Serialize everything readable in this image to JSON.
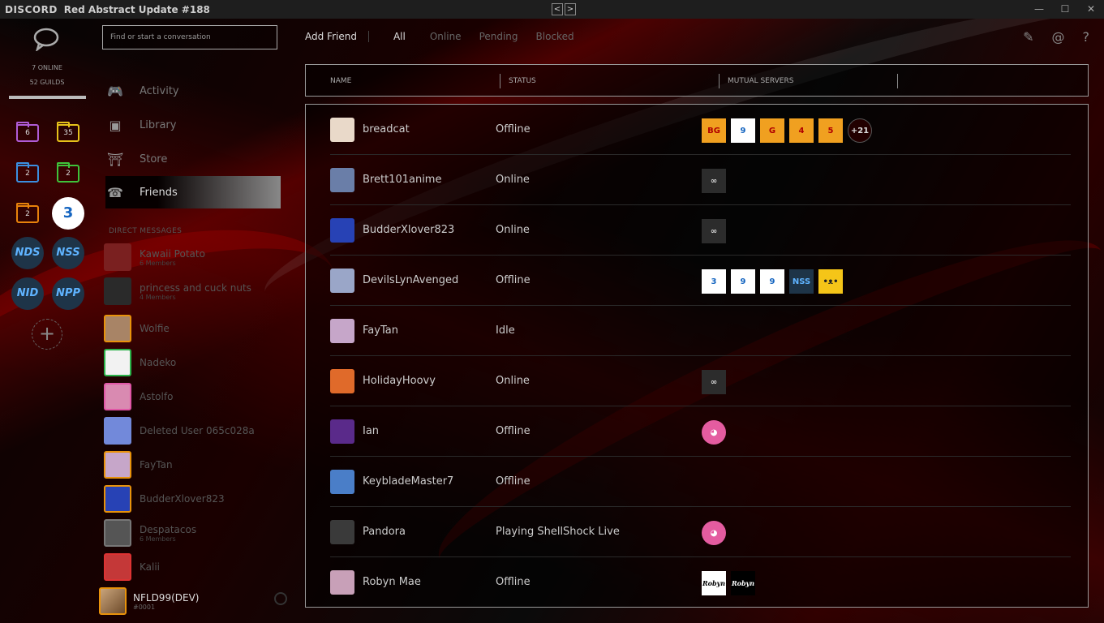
{
  "titlebar": {
    "brand": "DISCORD",
    "title": "Red Abstract Update #188",
    "back": "<",
    "forward": ">",
    "minimize": "—",
    "maximize": "☐",
    "close": "✕"
  },
  "rail": {
    "online": "7 ONLINE",
    "guilds": "52 GUILDS",
    "folders": [
      {
        "count": "6",
        "color": "#b05cd6"
      },
      {
        "count": "35",
        "color": "#e6c21a"
      },
      {
        "count": "2",
        "color": "#3b8fe0"
      },
      {
        "count": "2",
        "color": "#3fc23a"
      },
      {
        "count": "2",
        "color": "#e8820b"
      }
    ],
    "servers": [
      "NDS",
      "NSS",
      "NID",
      "NPP"
    ],
    "add": "+"
  },
  "search": {
    "placeholder": "Find or start a conversation"
  },
  "nav": {
    "activity": "Activity",
    "library": "Library",
    "store": "Store",
    "friends": "Friends"
  },
  "dm_header": "DIRECT MESSAGES",
  "dms": [
    {
      "name": "Kawaii Potato",
      "sub": "6 Members",
      "color": "#7a2020"
    },
    {
      "name": "princess and cuck nuts",
      "sub": "4 Members",
      "color": "#2a2a2a"
    },
    {
      "name": "Wolfie",
      "sub": "",
      "color": "#a88466"
    },
    {
      "name": "Nadeko",
      "sub": "",
      "color": "#f2f2f2"
    },
    {
      "name": "Astolfo",
      "sub": "",
      "color": "#d98ab1"
    },
    {
      "name": "Deleted User 065c028a",
      "sub": "",
      "color": "#7289da"
    },
    {
      "name": "FayTan",
      "sub": "",
      "color": "#c6a6c9"
    },
    {
      "name": "BudderXlover823",
      "sub": "",
      "color": "#2742b5"
    },
    {
      "name": "Despatacos",
      "sub": "6 Members",
      "color": "#555555"
    },
    {
      "name": "Kalii",
      "sub": "",
      "color": "#c43838"
    }
  ],
  "me": {
    "name": "NFLD99(DEV)",
    "tag": "#0001"
  },
  "tabs": {
    "add_friend": "Add Friend",
    "all": "All",
    "online": "Online",
    "pending": "Pending",
    "blocked": "Blocked"
  },
  "columns": {
    "name": "NAME",
    "status": "STATUS",
    "mutual": "MUTUAL SERVERS"
  },
  "friends": [
    {
      "name": "breadcat",
      "status": "Offline",
      "color": "#e9d9c9",
      "mutual": [
        {
          "label": "BG",
          "bg": "#f0a020",
          "fg": "#b00000"
        },
        {
          "label": "9",
          "bg": "#ffffff",
          "fg": "#1565c0"
        },
        {
          "label": "G",
          "bg": "#f0a020",
          "fg": "#b00000"
        },
        {
          "label": "4",
          "bg": "#f0a020",
          "fg": "#b00000"
        },
        {
          "label": "5",
          "bg": "#f0a020",
          "fg": "#b00000"
        },
        {
          "label": "+21",
          "bg": "#220000",
          "fg": "#dddddd"
        }
      ]
    },
    {
      "name": "Brett101anime",
      "status": "Online",
      "color": "#6a7ea8",
      "mutual": [
        {
          "label": "∞",
          "bg": "#2c2c2c",
          "fg": "#dddddd"
        }
      ]
    },
    {
      "name": "BudderXlover823",
      "status": "Online",
      "color": "#2742b5",
      "mutual": [
        {
          "label": "∞",
          "bg": "#2c2c2c",
          "fg": "#dddddd"
        }
      ]
    },
    {
      "name": "DevilsLynAvenged",
      "status": "Offline",
      "color": "#9aa6c8",
      "mutual": [
        {
          "label": "3",
          "bg": "#ffffff",
          "fg": "#1565c0"
        },
        {
          "label": "9",
          "bg": "#ffffff",
          "fg": "#1565c0"
        },
        {
          "label": "9",
          "bg": "#ffffff",
          "fg": "#1565c0"
        },
        {
          "label": "NSS",
          "bg": "#1e3448",
          "fg": "#5fb3ff"
        },
        {
          "label": "•ᴥ•",
          "bg": "#f5c518",
          "fg": "#222222"
        }
      ]
    },
    {
      "name": "FayTan",
      "status": "Idle",
      "color": "#c6a6c9",
      "mutual": []
    },
    {
      "name": "HolidayHoovy",
      "status": "Online",
      "color": "#e06a2a",
      "mutual": [
        {
          "label": "∞",
          "bg": "#2c2c2c",
          "fg": "#dddddd"
        }
      ]
    },
    {
      "name": "Ian",
      "status": "Offline",
      "color": "#5a2a8a",
      "mutual": [
        {
          "label": "◕",
          "bg": "#e45ca0",
          "fg": "#ffffff"
        }
      ]
    },
    {
      "name": "KeybladeMaster7",
      "status": "Offline",
      "color": "#4a7ec8",
      "mutual": []
    },
    {
      "name": "Pandora",
      "status": "Playing ShellShock Live",
      "color": "#3a3a3a",
      "mutual": [
        {
          "label": "◕",
          "bg": "#e45ca0",
          "fg": "#ffffff"
        }
      ]
    },
    {
      "name": "Robyn Mae",
      "status": "Offline",
      "color": "#c8a0b8",
      "mutual": [
        {
          "label": "Robyn",
          "bg": "#ffffff",
          "fg": "#000000"
        },
        {
          "label": "Robyn",
          "bg": "#000000",
          "fg": "#ffffff"
        }
      ]
    }
  ]
}
